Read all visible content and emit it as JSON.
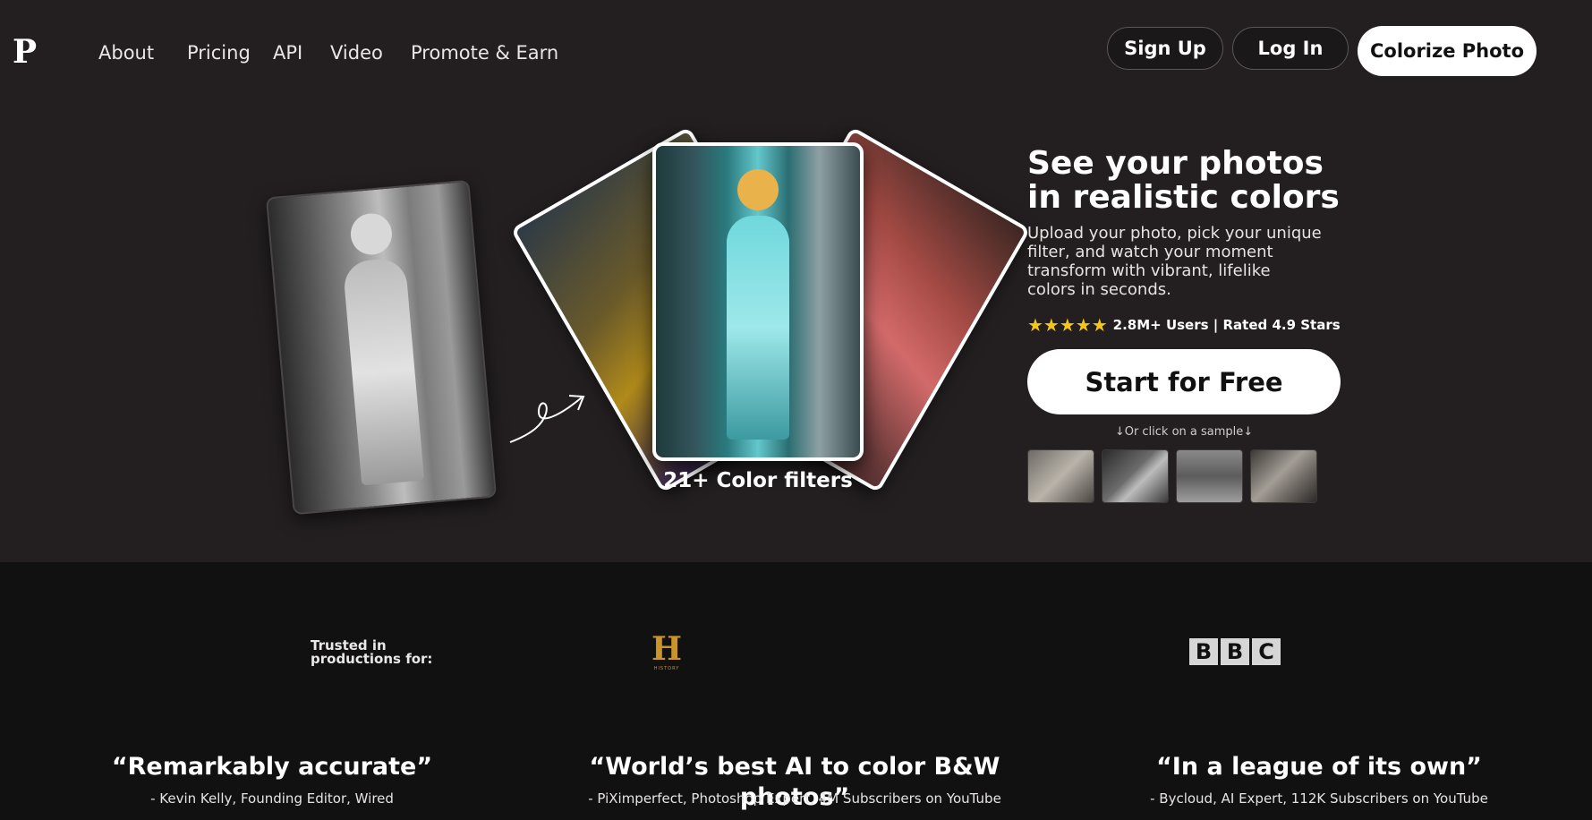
{
  "header": {
    "logo": "P",
    "nav": [
      "About",
      "Pricing",
      "API",
      "Video",
      "Promote & Earn"
    ],
    "sign_up": "Sign Up",
    "log_in": "Log In",
    "colorize": "Colorize Photo"
  },
  "hero": {
    "title": "See your photos in realistic colors",
    "subtitle": "Upload your photo, pick your unique filter, and watch your moment transform with vibrant, lifelike colors in seconds.",
    "stars": "★★★★★",
    "rating_text": "2.8M+ Users | Rated 4.9 Stars",
    "rating_value": 4.9,
    "cta": "Start for Free",
    "sample_hint": "↓Or click on a sample↓",
    "filters_label": "21+ Color filters"
  },
  "trusted": {
    "label_line1": "Trusted in",
    "label_line2": "productions for:",
    "history_letter": "H",
    "history_sub": "HISTORY",
    "bbc_letters": [
      "B",
      "B",
      "C"
    ]
  },
  "quotes": [
    {
      "text": "“Remarkably accurate”",
      "source": "- Kevin Kelly, Founding Editor, Wired"
    },
    {
      "text": "“World’s best AI to color B&W photos”",
      "source": "- PiXimperfect, Photoshop Expert, 4M Subscribers on YouTube"
    },
    {
      "text": "“In a league of its own”",
      "source": "- Bycloud, AI Expert, 112K Subscribers on YouTube"
    }
  ],
  "colors": {
    "hero_bg": "#231f20",
    "page_bg": "#121112",
    "star": "#f5c518",
    "history_gold": "#c9942a"
  }
}
